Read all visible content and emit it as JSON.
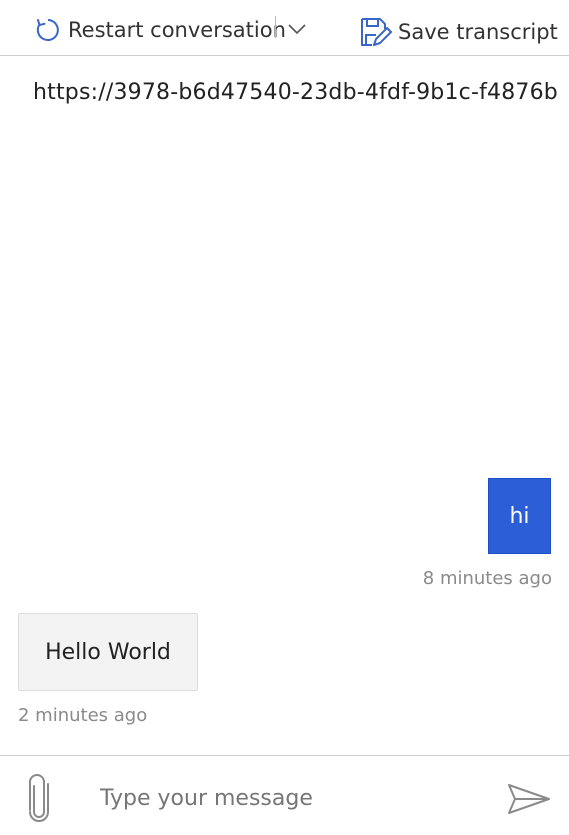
{
  "toolbar": {
    "restart_label": "Restart conversation",
    "save_label": "Save transcript",
    "accent_color": "#3a66c7"
  },
  "conversation": {
    "url_text": "https://3978-b6d47540-23db-4fdf-9b1c-f4876b",
    "messages": [
      {
        "from": "user",
        "text": "hi",
        "time": "8 minutes ago",
        "bubble_color": "#2c5fd7"
      },
      {
        "from": "bot",
        "text": "Hello World",
        "time": "2 minutes ago",
        "bubble_color": "#f3f3f3"
      }
    ]
  },
  "input": {
    "placeholder": "Type your message",
    "value": ""
  },
  "icons": {
    "restart": "restart-icon",
    "chevron": "chevron-down-icon",
    "save": "save-icon",
    "attach": "paperclip-icon",
    "send": "send-icon"
  }
}
